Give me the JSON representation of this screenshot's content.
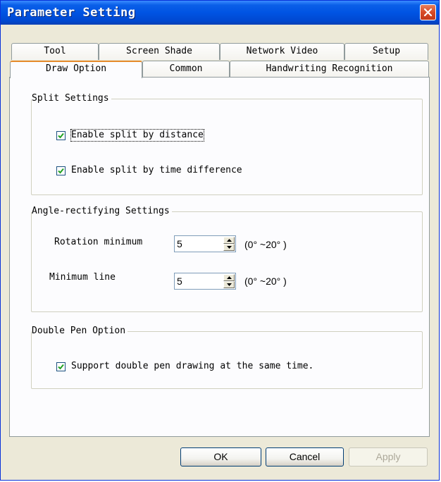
{
  "window": {
    "title": "Parameter Setting"
  },
  "tabs": {
    "row1": [
      {
        "label": "Tool"
      },
      {
        "label": "Screen Shade"
      },
      {
        "label": "Network Video"
      },
      {
        "label": "Setup"
      }
    ],
    "row2": [
      {
        "label": "Draw Option",
        "active": true
      },
      {
        "label": "Common"
      },
      {
        "label": "Handwriting Recognition"
      }
    ]
  },
  "split": {
    "caption": "Split Settings",
    "by_distance": {
      "label": "Enable split by distance",
      "checked": true
    },
    "by_time": {
      "label": "Enable split by time difference",
      "checked": true
    }
  },
  "angle": {
    "caption": "Angle-rectifying Settings",
    "rotation": {
      "label": "Rotation minimum",
      "value": "5",
      "range": "(0° ~20° )"
    },
    "min_line": {
      "label": "Minimum line",
      "value": "5",
      "range": "(0° ~20° )"
    }
  },
  "double_pen": {
    "caption": "Double Pen Option",
    "support": {
      "label": "Support double pen drawing at the same time.",
      "checked": true
    }
  },
  "buttons": {
    "ok": "OK",
    "cancel": "Cancel",
    "apply": "Apply"
  },
  "colors": {
    "title_bar": "#0054e3",
    "active_tab_accent": "#e68b2c",
    "close_button": "#d74a26"
  }
}
